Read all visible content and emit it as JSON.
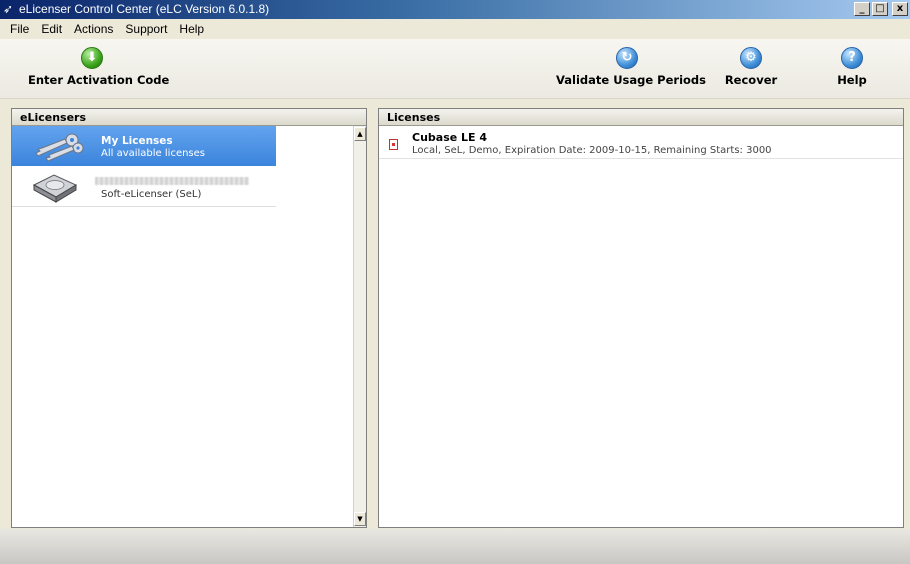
{
  "window": {
    "title": "eLicenser Control Center (eLC Version 6.0.1.8)",
    "buttons": {
      "minimize": "_",
      "maximize": "□",
      "close": "x"
    }
  },
  "menu": [
    "File",
    "Edit",
    "Actions",
    "Support",
    "Help"
  ],
  "toolbar": {
    "enter_activation_code": "Enter Activation Code",
    "validate_usage_periods": "Validate Usage Periods",
    "recover": "Recover",
    "help": "Help"
  },
  "elicensers_panel": {
    "title": "eLicensers",
    "items": [
      {
        "name": "My Licenses",
        "subtitle": "All available licenses",
        "icon": "keys-icon",
        "selected": true
      },
      {
        "name": "",
        "subtitle": "Soft-eLicenser (SeL)",
        "icon": "hard-drive-icon",
        "selected": false
      }
    ]
  },
  "licenses_panel": {
    "title": "Licenses",
    "rows": [
      {
        "title": "Cubase LE 4",
        "description": "Local, SeL, Demo, Expiration Date: 2009-10-15, Remaining Starts: 3000",
        "icon": "license-document-icon"
      }
    ]
  },
  "colors": {
    "titlebar_start": "#0a246a",
    "titlebar_end": "#a6caf0",
    "selection": "#3b84dc"
  }
}
